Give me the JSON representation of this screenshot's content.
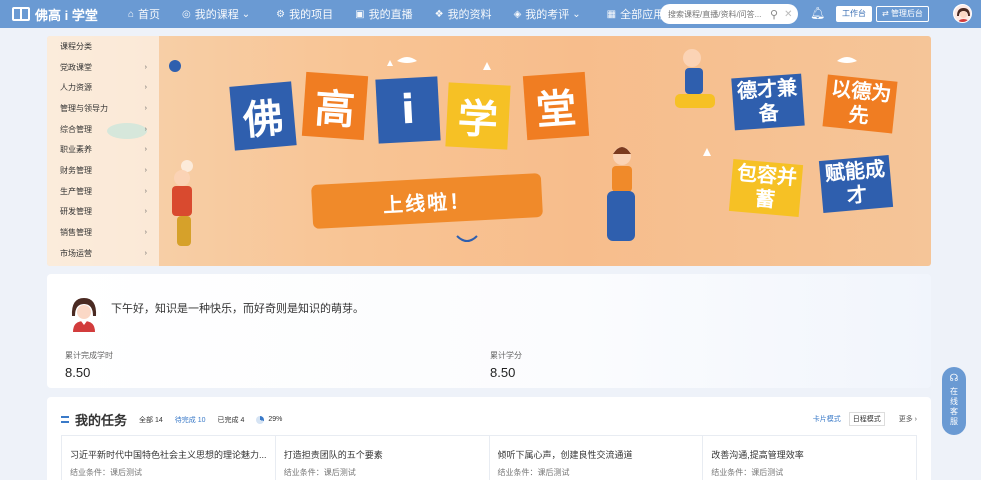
{
  "app": {
    "logo_text": "佛高 i 学堂"
  },
  "nav": [
    {
      "icon": "home-icon",
      "glyph": "⌂",
      "label": "首页"
    },
    {
      "icon": "courses-icon",
      "glyph": "◎",
      "label": "我的课程",
      "dropdown": "⌄"
    },
    {
      "icon": "projects-icon",
      "glyph": "⚙",
      "label": "我的项目"
    },
    {
      "icon": "live-icon",
      "glyph": "▣",
      "label": "我的直播"
    },
    {
      "icon": "resources-icon",
      "glyph": "❖",
      "label": "我的资料"
    },
    {
      "icon": "exam-icon",
      "glyph": "◈",
      "label": "我的考评",
      "dropdown": "⌄"
    },
    {
      "icon": "apps-icon",
      "glyph": "▦",
      "label": "全部应用"
    }
  ],
  "search": {
    "placeholder": "搜索课程/直播/资料/问答..."
  },
  "header_buttons": {
    "workbench": "工作台",
    "admin": "管理后台"
  },
  "categories": [
    {
      "label": "课程分类"
    },
    {
      "label": "党政课堂"
    },
    {
      "label": "人力资源"
    },
    {
      "label": "管理与领导力"
    },
    {
      "label": "综合管理"
    },
    {
      "label": "职业素养"
    },
    {
      "label": "财务管理"
    },
    {
      "label": "生产管理"
    },
    {
      "label": "研发管理"
    },
    {
      "label": "销售管理"
    },
    {
      "label": "市场运营"
    }
  ],
  "banner": {
    "title_chars": [
      "佛",
      "高",
      "i",
      "学",
      "堂"
    ],
    "ribbon": "上线啦！",
    "slogans": [
      "德才兼备",
      "以德为先",
      "包容并蓄",
      "赋能成才"
    ],
    "colors": {
      "blue": "#2f5fae",
      "orange": "#f07d22",
      "yellow": "#f6c125"
    }
  },
  "greeting": {
    "text": "下午好，知识是一种快乐，而好奇则是知识的萌芽。",
    "stats": [
      {
        "label": "累计完成学时",
        "value": "8.50"
      },
      {
        "label": "累计学分",
        "value": "8.50"
      }
    ]
  },
  "tasks": {
    "title": "我的任务",
    "tabs": [
      {
        "label": "全部",
        "count": "14"
      },
      {
        "label": "待完成",
        "count": "10"
      },
      {
        "label": "已完成",
        "count": "4"
      }
    ],
    "progress": "29%",
    "view_modes": [
      "卡片模式",
      "日程模式"
    ],
    "more": "更多",
    "items": [
      {
        "title": "习近平新时代中国特色社会主义思想的理论魅力...",
        "sub": "结业条件：课后测试"
      },
      {
        "title": "打造担责团队的五个要素",
        "sub": "结业条件：课后测试"
      },
      {
        "title": "倾听下属心声，创建良性交流通道",
        "sub": "结业条件：课后测试"
      },
      {
        "title": "改善沟通,提高管理效率",
        "sub": "结业条件：课后测试"
      }
    ]
  },
  "float_cs": {
    "label": "在线客服"
  }
}
